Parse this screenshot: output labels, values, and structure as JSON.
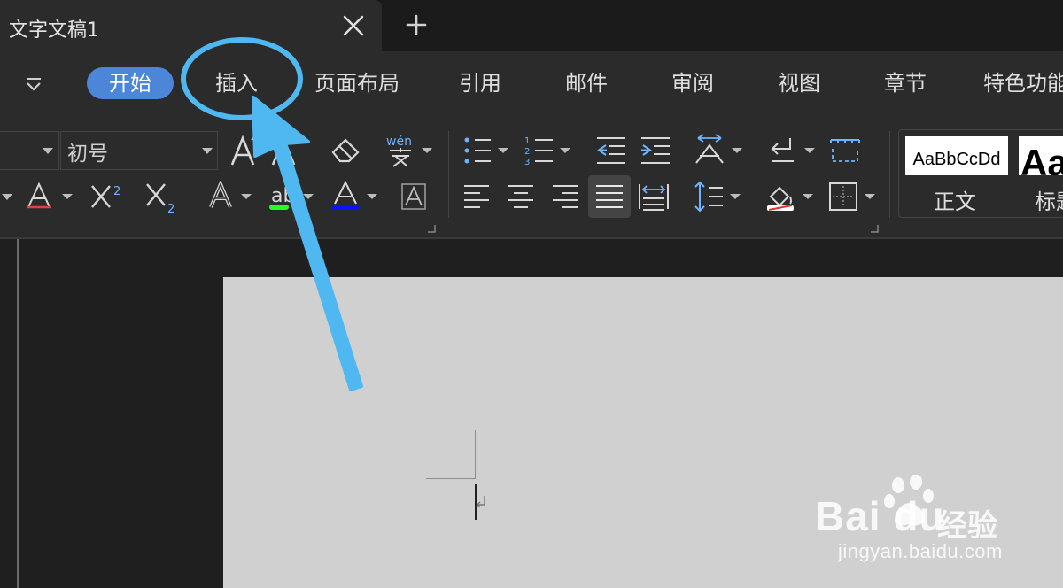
{
  "tabbar": {
    "document_tab_title": "文字文稿1",
    "close_icon": "close-icon",
    "new_tab_icon": "plus-icon"
  },
  "ribbon": {
    "menu_tabs": [
      "开始",
      "插入",
      "页面布局",
      "引用",
      "邮件",
      "审阅",
      "视图",
      "章节",
      "特色功能"
    ],
    "active_tab": "开始",
    "font_group": {
      "font_name": "",
      "font_size": "初号"
    },
    "styles": {
      "normal_preview": "AaBbCcDd",
      "normal_label": "正文",
      "heading_preview": "Aa",
      "heading_label": "标题"
    },
    "pinyin_icon_label": "wén"
  },
  "annotation": {
    "highlighted_tab": "插入",
    "color": "#4fb8f0"
  },
  "watermark": {
    "brand": "Bai du",
    "cn": "经验",
    "url": "jingyan.baidu.com"
  },
  "colors": {
    "accent": "#4c86d8",
    "ribbon_bg": "#2b2b2b",
    "tabbar_bg": "#1b1b1b",
    "page_bg": "#d0d0d0"
  }
}
